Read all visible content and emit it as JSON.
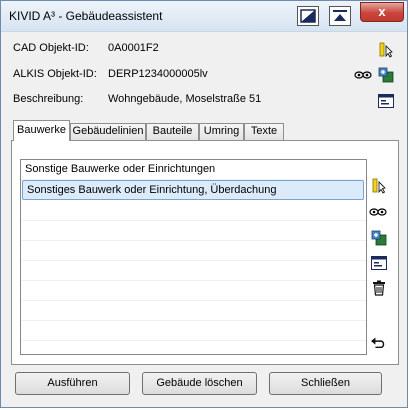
{
  "window": {
    "title": "KIVID A³ - Gebäudeassistent",
    "close_label": "x"
  },
  "fields": {
    "cad": {
      "label": "CAD Objekt-ID:",
      "value": "0A0001F2"
    },
    "alkis": {
      "label": "ALKIS Objekt-ID:",
      "value": "DERP1234000005lv"
    },
    "desc": {
      "label": "Beschreibung:",
      "value": "Wohngebäude, Moselstraße 51"
    }
  },
  "tabs": [
    {
      "label": "Bauwerke",
      "active": true
    },
    {
      "label": "Gebäudelinien",
      "active": false
    },
    {
      "label": "Bauteile",
      "active": false
    },
    {
      "label": "Umring",
      "active": false
    },
    {
      "label": "Texte",
      "active": false
    }
  ],
  "list": {
    "header": "Sonstige Bauwerke oder Einrichtungen",
    "items": [
      {
        "text": "Sonstiges Bauwerk oder Einrichtung, Überdachung",
        "selected": true
      }
    ]
  },
  "buttons": {
    "execute": "Ausführen",
    "delete": "Gebäude löschen",
    "close": "Schließen"
  },
  "icons": {
    "side": [
      "select-pointer-icon",
      "view-icon",
      "add-layer-icon",
      "form-icon"
    ],
    "list_side": [
      "select-pointer-icon",
      "view-icon",
      "add-layer-icon",
      "form-icon",
      "trash-icon",
      "undo-icon"
    ]
  },
  "colors": {
    "selection": "#dcebfc",
    "titlebar": "#d6e3f1",
    "close": "#c9463d"
  }
}
